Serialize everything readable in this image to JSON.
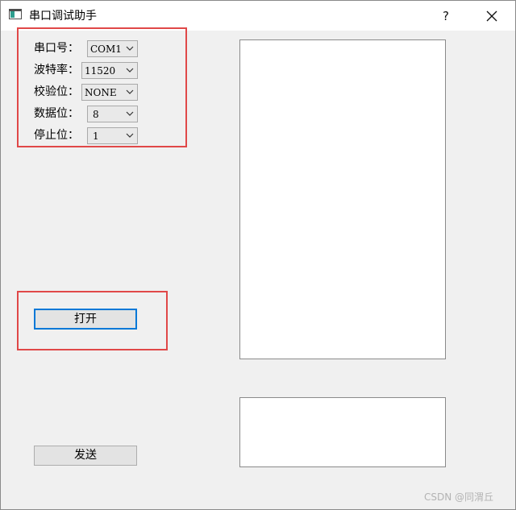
{
  "window": {
    "title": "串口调试助手",
    "help_label": "?"
  },
  "settings": {
    "port": {
      "label": "串口号：",
      "value": "COM1"
    },
    "baud": {
      "label": "波特率：",
      "value": "11520"
    },
    "parity": {
      "label": "校验位：",
      "value": "NONE"
    },
    "data_bits": {
      "label": "数据位：",
      "value": "8"
    },
    "stop_bits": {
      "label": "停止位：",
      "value": "1"
    }
  },
  "buttons": {
    "open_label": "打开",
    "send_label": "发送"
  },
  "receive_text": "",
  "send_text": "",
  "watermark": "CSDN @同渭丘",
  "colors": {
    "annotation_red": "#e04848",
    "focus_blue": "#0078d7",
    "window_bg": "#f0f0f0"
  }
}
